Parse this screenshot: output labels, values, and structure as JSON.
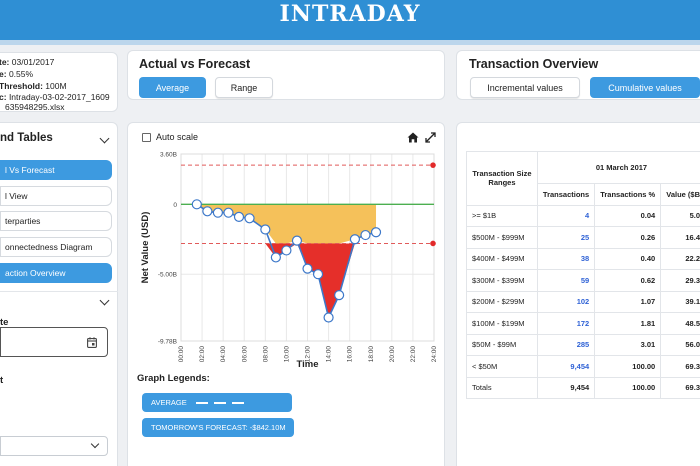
{
  "header": {
    "title": "INTRADAY"
  },
  "info": {
    "date_label": "te:",
    "date_value": "03/01/2017",
    "rate_label": "e:",
    "rate_value": "0.55%",
    "threshold_label": "Threshold:",
    "threshold_value": "100M",
    "file_label": "c:",
    "file_value_1": "Intraday-03-02-2017_1609",
    "file_value_2": "635948295.xlsx"
  },
  "actual_vs_forecast": {
    "title": "Actual vs Forecast",
    "average_label": "Average",
    "range_label": "Range"
  },
  "transaction_overview": {
    "title": "Transaction Overview",
    "incremental_label": "Incremental values",
    "cumulative_label": "Cumulative values"
  },
  "sidebar": {
    "title": "nd Tables",
    "items": [
      {
        "label": "l Vs Forecast",
        "active": true
      },
      {
        "label": "l View",
        "active": false
      },
      {
        "label": "terparties",
        "active": false
      },
      {
        "label": "onnectedness Diagram",
        "active": false
      },
      {
        "label": "action Overview",
        "active": true
      }
    ],
    "date_field_label": "te",
    "calendar_icon": "calendar-icon",
    "section_char": "t"
  },
  "graph": {
    "autoscale_label": "Auto scale",
    "home_icon": "home-icon",
    "expand_icon": "expand-icon",
    "legends_title": "Graph Legends:",
    "legend_average": "AVERAGE",
    "legend_forecast": "TOMORROW'S FORECAST: -$842.10M"
  },
  "chart_data": {
    "type": "line",
    "xlabel": "Time",
    "ylabel": "Net Value (USD)",
    "ytick_labels": [
      "3.60B",
      "0",
      "-5.00B",
      "-9.78B"
    ],
    "y_ticks": [
      3.6,
      0,
      -5.0,
      -9.78
    ],
    "ylim": [
      -9.78,
      3.6
    ],
    "x_ticks": [
      "00:00",
      "02:00",
      "04:00",
      "06:00",
      "08:00",
      "10:00",
      "12:00",
      "14:00",
      "16:00",
      "18:00",
      "20:00",
      "22:00",
      "24:00"
    ],
    "xlim": [
      0,
      24
    ],
    "upper_range": 2.8,
    "lower_range": -2.8,
    "series": [
      {
        "x": [
          1.5,
          2.5,
          3.5,
          4.5,
          5.5,
          6.5,
          8.0,
          9.0,
          10.0,
          11.0,
          12.0,
          13.0,
          14.0,
          15.0,
          16.5,
          17.5,
          18.5
        ],
        "y": [
          0.0,
          -0.5,
          -0.6,
          -0.6,
          -0.9,
          -1.0,
          -1.8,
          -3.8,
          -3.3,
          -2.6,
          -4.6,
          -5.0,
          -8.1,
          -6.5,
          -2.5,
          -2.2,
          -2.0
        ]
      }
    ],
    "colors": {
      "line": "#3d78c9",
      "fill_yellow": "#f5c15a",
      "fill_red": "#e52f2a",
      "zero_line": "#4caf50",
      "range_line": "#e15a5a"
    },
    "grid": true
  },
  "table": {
    "headers": {
      "ranges": "Transaction Size Ranges",
      "date": "01 March 2017",
      "transactions": "Transactions",
      "transactions_pct": "Transactions %",
      "value": "Value ($B"
    },
    "rows": [
      {
        "range": ">= $1B",
        "tx": "4",
        "pct": "0.04",
        "val": "5.0"
      },
      {
        "range": "$500M - $999M",
        "tx": "25",
        "pct": "0.26",
        "val": "16.4"
      },
      {
        "range": "$400M - $499M",
        "tx": "38",
        "pct": "0.40",
        "val": "22.2"
      },
      {
        "range": "$300M - $399M",
        "tx": "59",
        "pct": "0.62",
        "val": "29.3"
      },
      {
        "range": "$200M - $299M",
        "tx": "102",
        "pct": "1.07",
        "val": "39.1"
      },
      {
        "range": "$100M - $199M",
        "tx": "172",
        "pct": "1.81",
        "val": "48.5"
      },
      {
        "range": "$50M - $99M",
        "tx": "285",
        "pct": "3.01",
        "val": "56.0"
      },
      {
        "range": "< $50M",
        "tx": "9,454",
        "pct": "100.00",
        "val": "69.3"
      },
      {
        "range": "Totals",
        "tx": "9,454",
        "pct": "100.00",
        "val": "69.3"
      }
    ]
  }
}
